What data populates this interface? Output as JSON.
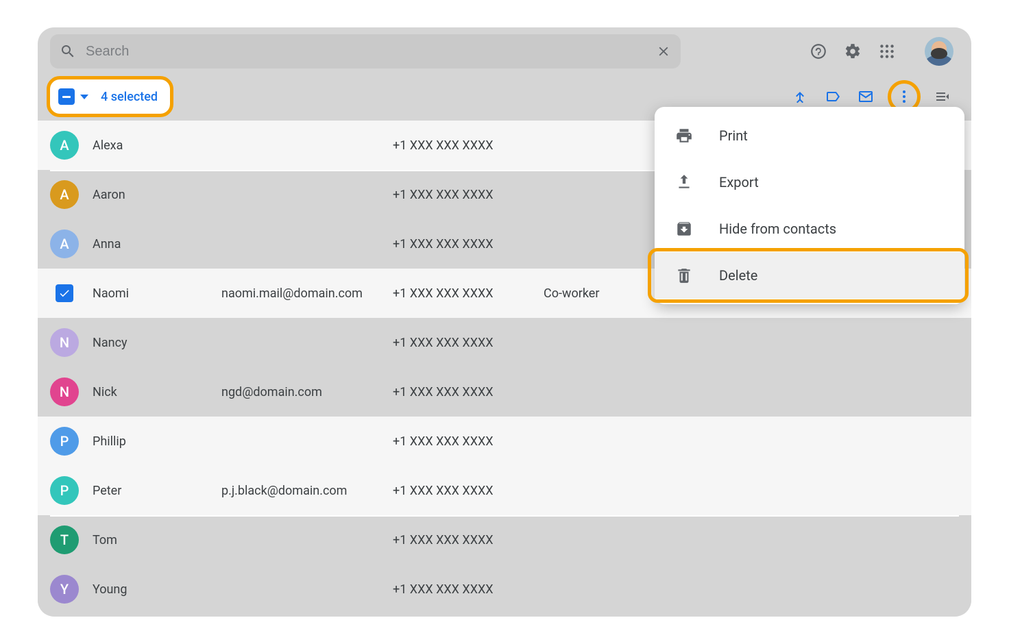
{
  "search": {
    "placeholder": "Search"
  },
  "selection": {
    "count_label": "4 selected"
  },
  "menu": {
    "items": [
      {
        "label": "Print"
      },
      {
        "label": "Export"
      },
      {
        "label": "Hide from contacts"
      },
      {
        "label": "Delete"
      }
    ]
  },
  "contacts": [
    {
      "initial": "A",
      "color": "#33c6bb",
      "name": "Alexa",
      "email": "",
      "phone": "+1 XXX XXX XXXX",
      "label": "",
      "selected": true,
      "checked": false
    },
    {
      "initial": "A",
      "color": "#d99a1e",
      "name": "Aaron",
      "email": "",
      "phone": "+1 XXX XXX XXXX",
      "label": "",
      "selected": false,
      "checked": false
    },
    {
      "initial": "A",
      "color": "#8cb3e8",
      "name": "Anna",
      "email": "",
      "phone": "+1 XXX XXX XXXX",
      "label": "",
      "selected": false,
      "checked": false
    },
    {
      "initial": "",
      "color": "",
      "name": "Naomi",
      "email": "naomi.mail@domain.com",
      "phone": "+1 XXX XXX XXXX",
      "label": "Co-worker",
      "selected": true,
      "checked": true
    },
    {
      "initial": "N",
      "color": "#bba9e1",
      "name": "Nancy",
      "email": "",
      "phone": "+1 XXX XXX XXXX",
      "label": "",
      "selected": false,
      "checked": false
    },
    {
      "initial": "N",
      "color": "#e1448f",
      "name": "Nick",
      "email": "ngd@domain.com",
      "phone": "+1 XXX XXX XXXX",
      "label": "",
      "selected": false,
      "checked": false
    },
    {
      "initial": "P",
      "color": "#4f9be8",
      "name": "Phillip",
      "email": "",
      "phone": "+1 XXX XXX XXXX",
      "label": "",
      "selected": true,
      "checked": false
    },
    {
      "initial": "P",
      "color": "#33c6bb",
      "name": "Peter",
      "email": "p.j.black@domain.com",
      "phone": "+1 XXX XXX XXXX",
      "label": "",
      "selected": true,
      "checked": false
    },
    {
      "initial": "T",
      "color": "#1f9c72",
      "name": "Tom",
      "email": "",
      "phone": "+1 XXX XXX XXXX",
      "label": "",
      "selected": false,
      "checked": false
    },
    {
      "initial": "Y",
      "color": "#9b88cf",
      "name": "Young",
      "email": "",
      "phone": "+1 XXX XXX XXXX",
      "label": "",
      "selected": false,
      "checked": false
    }
  ]
}
